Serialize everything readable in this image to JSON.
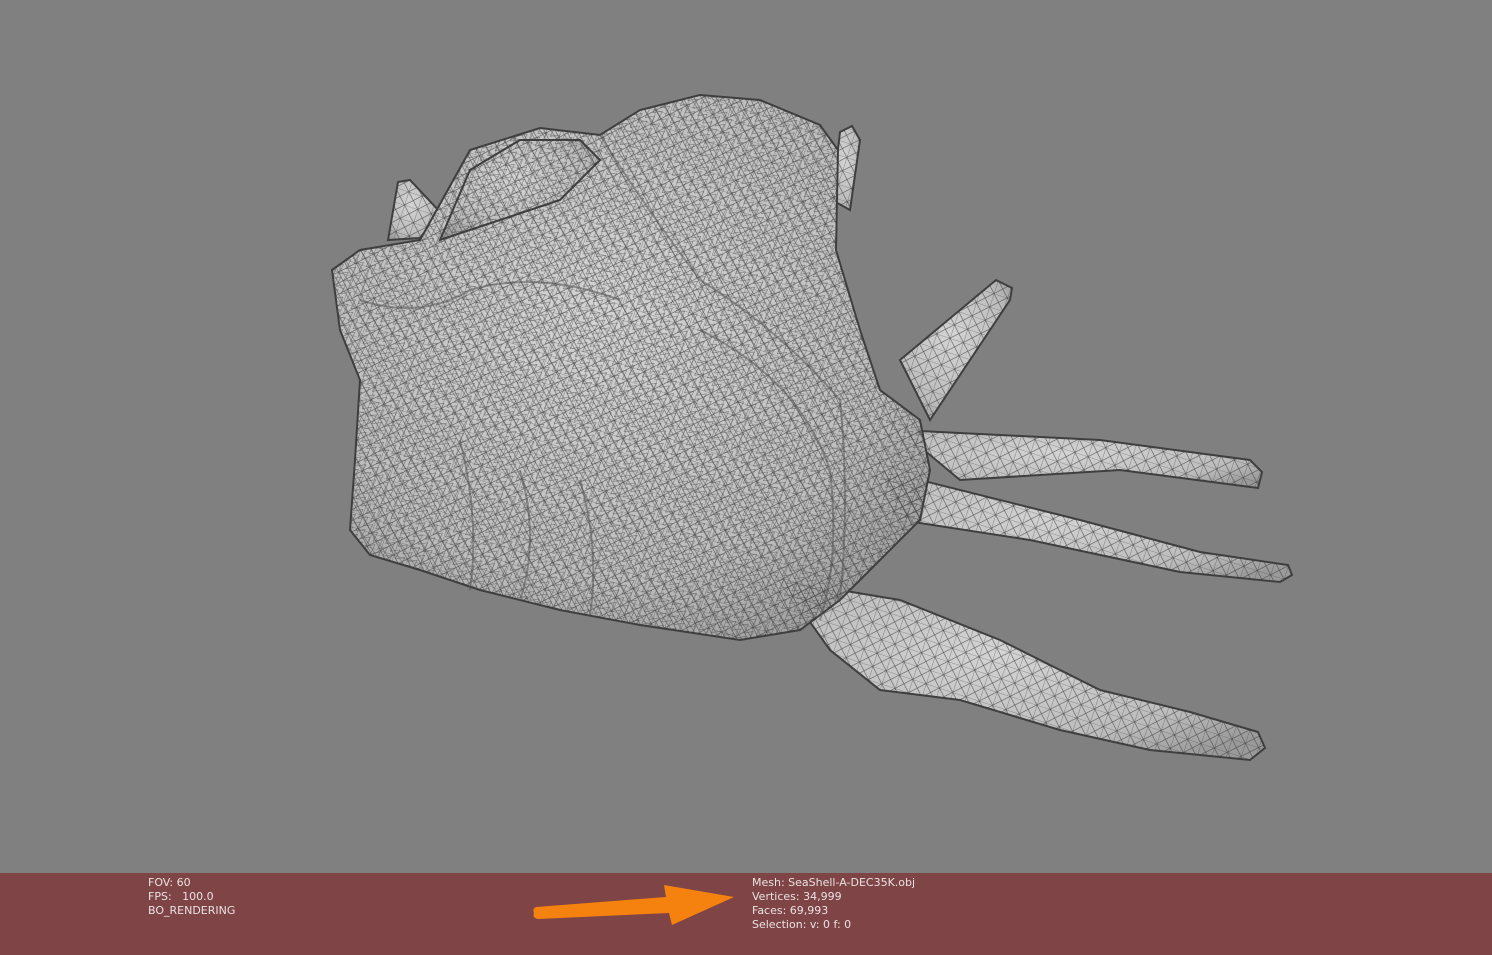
{
  "viewport": {
    "background_color": "#808080",
    "mesh_fill_color": "#c4c4c4",
    "wire_color": "#3a3a3a",
    "render_mode": "wireframe over shaded"
  },
  "status_bar": {
    "background_color": "#7f4446",
    "text_color": "#e8e2e2",
    "left": {
      "fov": "FOV: 60",
      "fps": "FPS:   100.0",
      "mode": "BO_RENDERING"
    },
    "right": {
      "mesh": "Mesh: SeaShell-A-DEC35K.obj",
      "vertices": "Vertices: 34,999",
      "faces": "Faces: 69,993",
      "selection": "Selection: v: 0 f: 0"
    },
    "annotation_arrow": {
      "icon": "arrow-right-icon",
      "color": "#f5820f"
    }
  }
}
